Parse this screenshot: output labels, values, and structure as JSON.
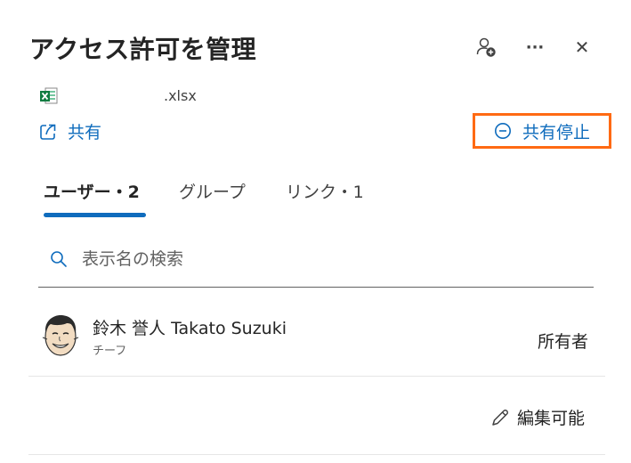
{
  "header": {
    "title": "アクセス許可を管理",
    "icons": {
      "add_person": "person-add-icon",
      "more": "more-icon",
      "close": "close-icon"
    },
    "more_glyph": "···",
    "close_glyph": "✕"
  },
  "file": {
    "name": ".xlsx",
    "icon": "excel-file-icon"
  },
  "actions": {
    "share_label": "共有",
    "stop_share_label": "共有停止"
  },
  "tabs": [
    {
      "label": "ユーザー・2",
      "active": true
    },
    {
      "label": "グループ",
      "active": false
    },
    {
      "label": "リンク・1",
      "active": false
    }
  ],
  "search": {
    "placeholder": "表示名の検索"
  },
  "users": [
    {
      "name": "鈴木 誉人 Takato Suzuki",
      "subtitle": "チーフ",
      "role": "所有者"
    }
  ],
  "permission": {
    "label": "編集可能"
  },
  "colors": {
    "accent": "#0f6cbd",
    "highlight_border": "#ff6a13",
    "excel_green": "#107c41"
  }
}
